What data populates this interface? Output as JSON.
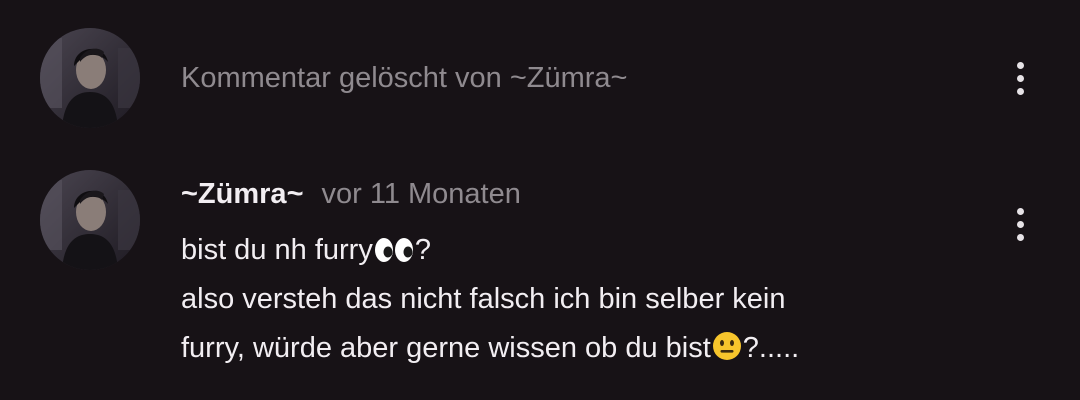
{
  "comments": [
    {
      "type": "deleted",
      "text": "Kommentar gelöscht von ~Zümra~",
      "menu_icon": "more-vertical-icon"
    },
    {
      "type": "comment",
      "author": "~Zümra~",
      "timestamp": "vor 11 Monaten",
      "lines": [
        {
          "before": "bist du nh furry",
          "emoji": "eyes-emoji",
          "after": "?"
        },
        {
          "before": "also versteh das nicht falsch ich bin selber kein",
          "emoji": "",
          "after": ""
        },
        {
          "before": "furry, würde aber gerne wissen ob du bist",
          "emoji": "neutral-face-emoji",
          "after": "?....."
        }
      ],
      "menu_icon": "more-vertical-icon"
    }
  ],
  "colors": {
    "background": "#171216",
    "author_text": "#f2eef2",
    "muted_text": "#8f8a8f",
    "body_text": "#f2eef2",
    "emoji_yellow": "#f7c52c"
  }
}
